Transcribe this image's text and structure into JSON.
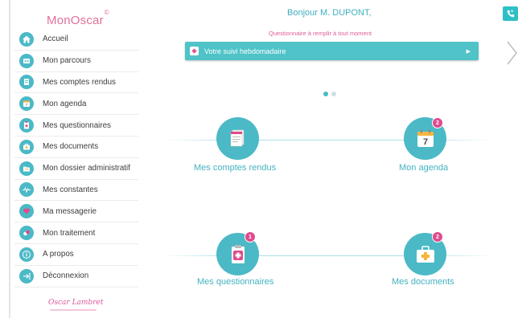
{
  "sidebar": {
    "logo": "MonOscar",
    "logo_mark": "©",
    "items": [
      {
        "label": "Accueil",
        "icon": "home-icon"
      },
      {
        "label": "Mon parcours",
        "icon": "parcours-icon"
      },
      {
        "label": "Mes comptes rendus",
        "icon": "documents-stack-icon"
      },
      {
        "label": "Mon agenda",
        "icon": "calendar-icon"
      },
      {
        "label": "Mes questionnaires",
        "icon": "clipboard-icon"
      },
      {
        "label": "Mes documents",
        "icon": "medical-case-icon"
      },
      {
        "label": "Mon dossier administratif",
        "icon": "folder-icon"
      },
      {
        "label": "Mes constantes",
        "icon": "heartbeat-icon"
      },
      {
        "label": "Ma messagerie",
        "icon": "message-icon"
      },
      {
        "label": "Mon traitement",
        "icon": "pills-icon"
      },
      {
        "label": "A propos",
        "icon": "info-icon"
      },
      {
        "label": "Déconnexion",
        "icon": "logout-icon"
      }
    ],
    "footer_brand": "Oscar Lambret"
  },
  "header": {
    "greeting": "Bonjour M. DUPONT,",
    "subtitle": "Questionnaire à remplir à tout moment"
  },
  "banner": {
    "label": "Votre suivi hebdomadaire",
    "arrow": "▶"
  },
  "carousel": {
    "pages": 2,
    "active": 1
  },
  "tiles": [
    {
      "label": "Mes comptes rendus",
      "icon": "documents-stack-icon",
      "badge": ""
    },
    {
      "label": "Mon agenda",
      "icon": "calendar-icon",
      "badge": "2",
      "calendar_day": "7"
    },
    {
      "label": "Mes questionnaires",
      "icon": "clipboard-icon",
      "badge": "1"
    },
    {
      "label": "Mes documents",
      "icon": "medical-case-icon",
      "badge": "2"
    }
  ],
  "colors": {
    "accent": "#4bb9c6",
    "banner": "#4fc3c8",
    "pink": "#df5d97",
    "badge": "#e04b8d"
  }
}
